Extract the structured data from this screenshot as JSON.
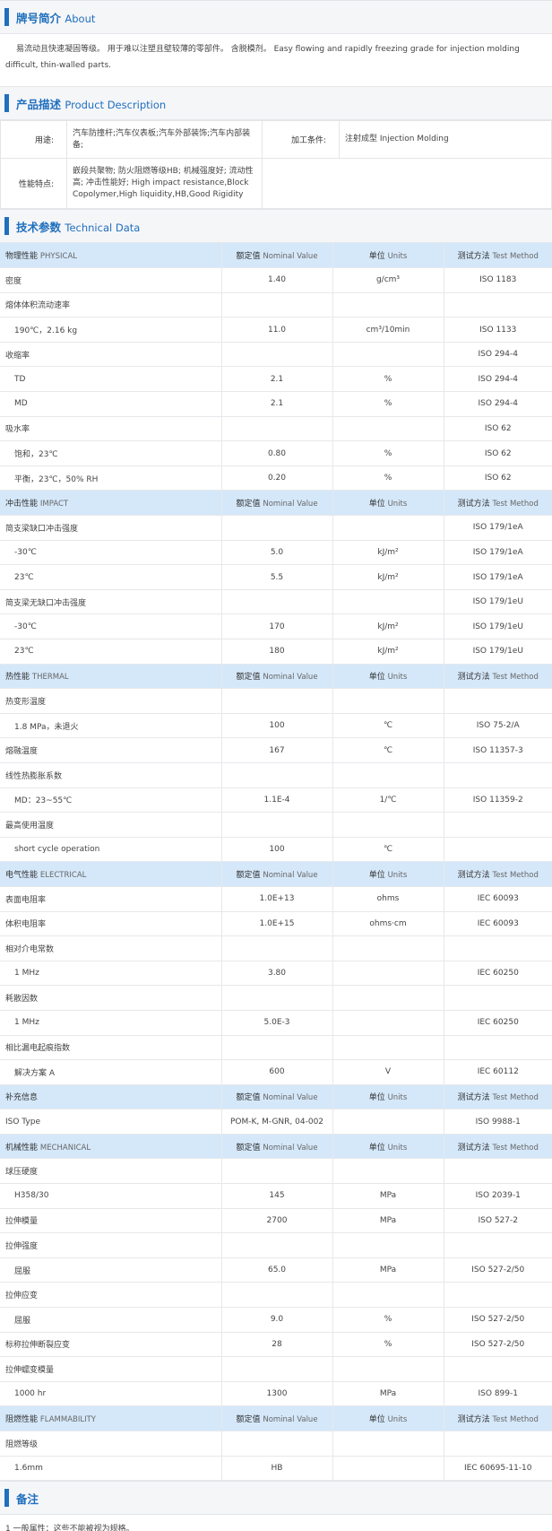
{
  "about": {
    "title_cn": "牌号简介",
    "title_en": "About",
    "text": "易流动且快速凝固等级。 用于难以注塑且壁较薄的零部件。 含脱模剂。 Easy flowing and rapidly freezing grade for injection molding difficult, thin-walled parts."
  },
  "description": {
    "title_cn": "产品描述",
    "title_en": "Product Description",
    "use_label": "用途:",
    "use_value": "汽车防撞杆;汽车仪表板;汽车外部装饰;汽车内部装备;",
    "process_label": "加工条件:",
    "process_value": "注射成型  Injection Molding",
    "feature_label": "性能特点:",
    "feature_value": "嵌段共聚物; 防火阻燃等级HB; 机械强度好; 流动性高; 冲击性能好;  High impact resistance,Block Copolymer,High liquidity,HB,Good Rigidity"
  },
  "technical": {
    "title_cn": "技术参数",
    "title_en": "Technical Data",
    "header": {
      "nominal_cn": "额定值",
      "nominal_en": "Nominal Value",
      "unit_cn": "单位",
      "unit_en": "Units",
      "method_cn": "测试方法",
      "method_en": "Test Method"
    },
    "rows": [
      {
        "t": "h",
        "name": "物理性能",
        "en": "PHYSICAL"
      },
      {
        "t": "r",
        "name": "密度",
        "value": "1.40",
        "unit": "g/cm³",
        "method": "ISO 1183"
      },
      {
        "t": "r",
        "name": "熔体体积流动速率",
        "value": "",
        "unit": "",
        "method": ""
      },
      {
        "t": "s",
        "name": "190℃，2.16 kg",
        "value": "11.0",
        "unit": "cm³/10min",
        "method": "ISO 1133",
        "link": true
      },
      {
        "t": "r",
        "name": "收缩率",
        "value": "",
        "unit": "",
        "method": "ISO 294-4"
      },
      {
        "t": "s",
        "name": "TD",
        "value": "2.1",
        "unit": "%",
        "method": "ISO 294-4"
      },
      {
        "t": "s",
        "name": "MD",
        "value": "2.1",
        "unit": "%",
        "method": "ISO 294-4"
      },
      {
        "t": "r",
        "name": "吸水率",
        "value": "",
        "unit": "",
        "method": "ISO 62",
        "link": true
      },
      {
        "t": "s",
        "name": "饱和，23℃",
        "value": "0.80",
        "unit": "%",
        "method": "ISO 62",
        "link": true
      },
      {
        "t": "s",
        "name": "平衡，23℃，50% RH",
        "value": "0.20",
        "unit": "%",
        "method": "ISO 62",
        "link": true
      },
      {
        "t": "h",
        "name": "冲击性能",
        "en": "IMPACT"
      },
      {
        "t": "r",
        "name": "简支梁缺口冲击强度",
        "value": "",
        "unit": "",
        "method": "ISO 179/1eA"
      },
      {
        "t": "s",
        "name": "-30℃",
        "value": "5.0",
        "unit": "kJ/m²",
        "method": "ISO 179/1eA"
      },
      {
        "t": "s",
        "name": "23℃",
        "value": "5.5",
        "unit": "kJ/m²",
        "method": "ISO 179/1eA"
      },
      {
        "t": "r",
        "name": "简支梁无缺口冲击强度",
        "value": "",
        "unit": "",
        "method": "ISO 179/1eU"
      },
      {
        "t": "s",
        "name": "-30℃",
        "value": "170",
        "unit": "kJ/m²",
        "method": "ISO 179/1eU"
      },
      {
        "t": "s",
        "name": "23℃",
        "value": "180",
        "unit": "kJ/m²",
        "method": "ISO 179/1eU"
      },
      {
        "t": "h",
        "name": "热性能",
        "en": "THERMAL"
      },
      {
        "t": "r",
        "name": "热变形温度",
        "value": "",
        "unit": "",
        "method": ""
      },
      {
        "t": "s",
        "name": "1.8 MPa，未退火",
        "value": "100",
        "unit": "℃",
        "method": "ISO 75-2/A"
      },
      {
        "t": "r",
        "name": "熔融温度",
        "value": "167",
        "unit": "℃",
        "method": "ISO 11357-3",
        "link": true
      },
      {
        "t": "r",
        "name": "线性热膨胀系数",
        "value": "",
        "unit": "",
        "method": ""
      },
      {
        "t": "s",
        "name": "MD：23~55℃",
        "value": "1.1E-4",
        "unit": "1/℃",
        "method": "ISO 11359-2"
      },
      {
        "t": "r",
        "name": "最高使用温度",
        "value": "",
        "unit": "",
        "method": ""
      },
      {
        "t": "s",
        "name": "short cycle operation",
        "value": "100",
        "unit": "℃",
        "method": ""
      },
      {
        "t": "h",
        "name": "电气性能",
        "en": "ELECTRICAL"
      },
      {
        "t": "r",
        "name": "表面电阻率",
        "value": "1.0E+13",
        "unit": "ohms",
        "method": "IEC 60093"
      },
      {
        "t": "r",
        "name": "体积电阻率",
        "value": "1.0E+15",
        "unit": "ohms·cm",
        "method": "IEC 60093"
      },
      {
        "t": "r",
        "name": "相对介电常数",
        "value": "",
        "unit": "",
        "method": ""
      },
      {
        "t": "s",
        "name": "1 MHz",
        "value": "3.80",
        "unit": "",
        "method": "IEC 60250"
      },
      {
        "t": "r",
        "name": "耗散因数",
        "value": "",
        "unit": "",
        "method": ""
      },
      {
        "t": "s",
        "name": "1 MHz",
        "value": "5.0E-3",
        "unit": "",
        "method": "IEC 60250"
      },
      {
        "t": "r",
        "name": "相比漏电起痕指数",
        "value": "",
        "unit": "",
        "method": ""
      },
      {
        "t": "s",
        "name": "解决方案 A",
        "value": "600",
        "unit": "V",
        "method": "IEC 60112"
      },
      {
        "t": "h",
        "name": "补充信息",
        "en": ""
      },
      {
        "t": "r",
        "name": "ISO Type",
        "value": "POM-K, M-GNR, 04-002",
        "unit": "",
        "method": "ISO 9988-1"
      },
      {
        "t": "h",
        "name": "机械性能",
        "en": "MECHANICAL"
      },
      {
        "t": "r",
        "name": "球压硬度",
        "value": "",
        "unit": "",
        "method": ""
      },
      {
        "t": "s",
        "name": "H358/30",
        "value": "145",
        "unit": "MPa",
        "method": "ISO 2039-1"
      },
      {
        "t": "r",
        "name": "拉伸模量",
        "value": "2700",
        "unit": "MPa",
        "method": "ISO 527-2",
        "link": true
      },
      {
        "t": "r",
        "name": "拉伸强度",
        "value": "",
        "unit": "",
        "method": ""
      },
      {
        "t": "s",
        "name": "屈服",
        "value": "65.0",
        "unit": "MPa",
        "method": "ISO 527-2/50"
      },
      {
        "t": "r",
        "name": "拉伸应变",
        "value": "",
        "unit": "",
        "method": ""
      },
      {
        "t": "s",
        "name": "屈服",
        "value": "9.0",
        "unit": "%",
        "method": "ISO 527-2/50"
      },
      {
        "t": "r",
        "name": "标称拉伸断裂应变",
        "value": "28",
        "unit": "%",
        "method": "ISO 527-2/50"
      },
      {
        "t": "r",
        "name": "拉伸蠕变模量",
        "value": "",
        "unit": "",
        "method": ""
      },
      {
        "t": "s",
        "name": "1000 hr",
        "value": "1300",
        "unit": "MPa",
        "method": "ISO 899-1"
      },
      {
        "t": "h",
        "name": "阻燃性能",
        "en": "FLAMMABILITY"
      },
      {
        "t": "r",
        "name": "阻燃等级",
        "value": "",
        "unit": "",
        "method": ""
      },
      {
        "t": "s",
        "name": "1.6mm",
        "value": "HB",
        "unit": "",
        "method": "IEC 60695-11-10"
      }
    ]
  },
  "notes": {
    "title_cn": "备注",
    "text": "1 一般属性：这些不能被视为规格。"
  },
  "colors": {
    "accent": "#1f6fbe",
    "header_row": "#d5e8fa",
    "link": "#4a7fc1"
  }
}
